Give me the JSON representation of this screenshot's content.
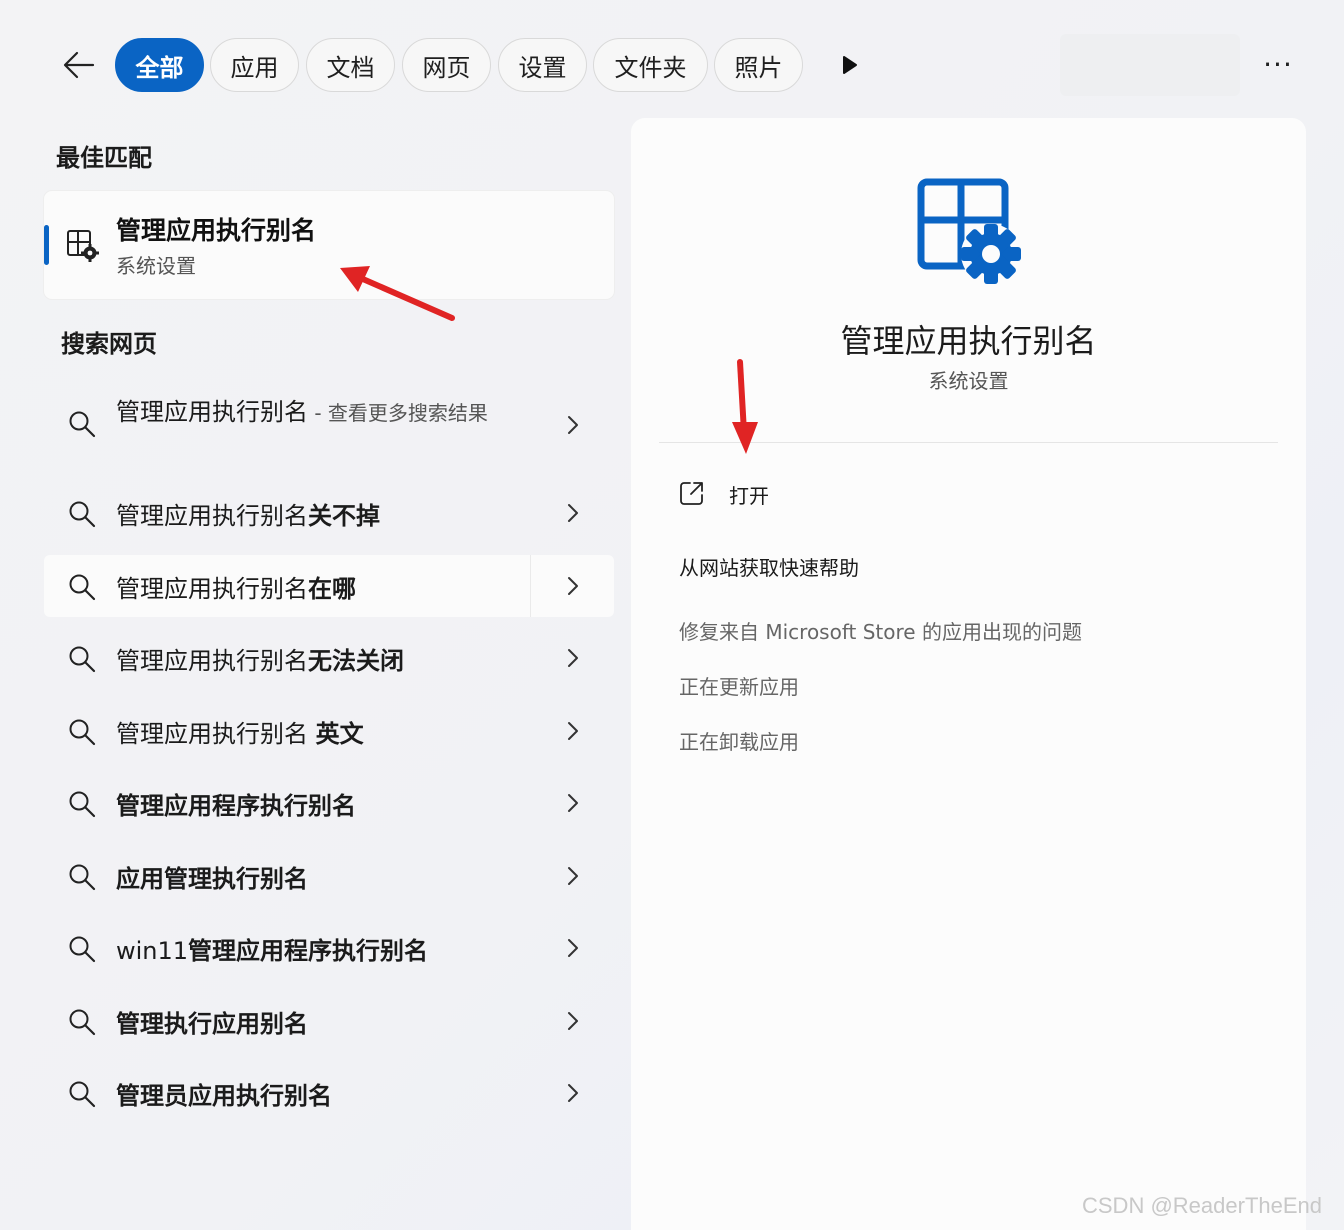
{
  "filters": {
    "tabs": [
      {
        "label": "全部",
        "active": true
      },
      {
        "label": "应用",
        "active": false
      },
      {
        "label": "文档",
        "active": false
      },
      {
        "label": "网页",
        "active": false
      },
      {
        "label": "设置",
        "active": false
      },
      {
        "label": "文件夹",
        "active": false
      },
      {
        "label": "照片",
        "active": false
      }
    ],
    "more_icon": "play-triangle-icon",
    "overflow_icon": "more-ellipsis-icon",
    "overflow_text": "···"
  },
  "best_match": {
    "section_title": "最佳匹配",
    "title": "管理应用执行别名",
    "subtitle": "系统设置",
    "icon": "app-settings-icon"
  },
  "web_search": {
    "section_title": "搜索网页",
    "first": {
      "query": "管理应用执行别名",
      "suffix": " - 查看更多搜索结果"
    },
    "results": [
      {
        "normal": "管理应用执行别名",
        "bold": "关不掉"
      },
      {
        "normal": "管理应用执行别名",
        "bold": "在哪"
      },
      {
        "normal": "管理应用执行别名",
        "bold": "无法关闭"
      },
      {
        "normal": "管理应用执行别名 ",
        "bold": "英文"
      },
      {
        "normal": "",
        "bold": "管理应用程序执行别名"
      },
      {
        "normal": "",
        "bold": "应用管理执行别名"
      },
      {
        "normal": "win11",
        "bold": "管理应用程序执行别名"
      },
      {
        "normal": "",
        "bold": "管理执行应用别名"
      },
      {
        "normal": "",
        "bold": "管理员应用执行别名"
      }
    ]
  },
  "detail": {
    "title": "管理应用执行别名",
    "subtitle": "系统设置",
    "open_label": "打开",
    "help_title": "从网站获取快速帮助",
    "help_links": [
      "修复来自 Microsoft Store 的应用出现的问题",
      "正在更新应用",
      "正在卸载应用"
    ]
  },
  "colors": {
    "accent": "#0a64c4",
    "annotation_arrow": "#e02424"
  },
  "watermark": "CSDN @ReaderTheEnd"
}
